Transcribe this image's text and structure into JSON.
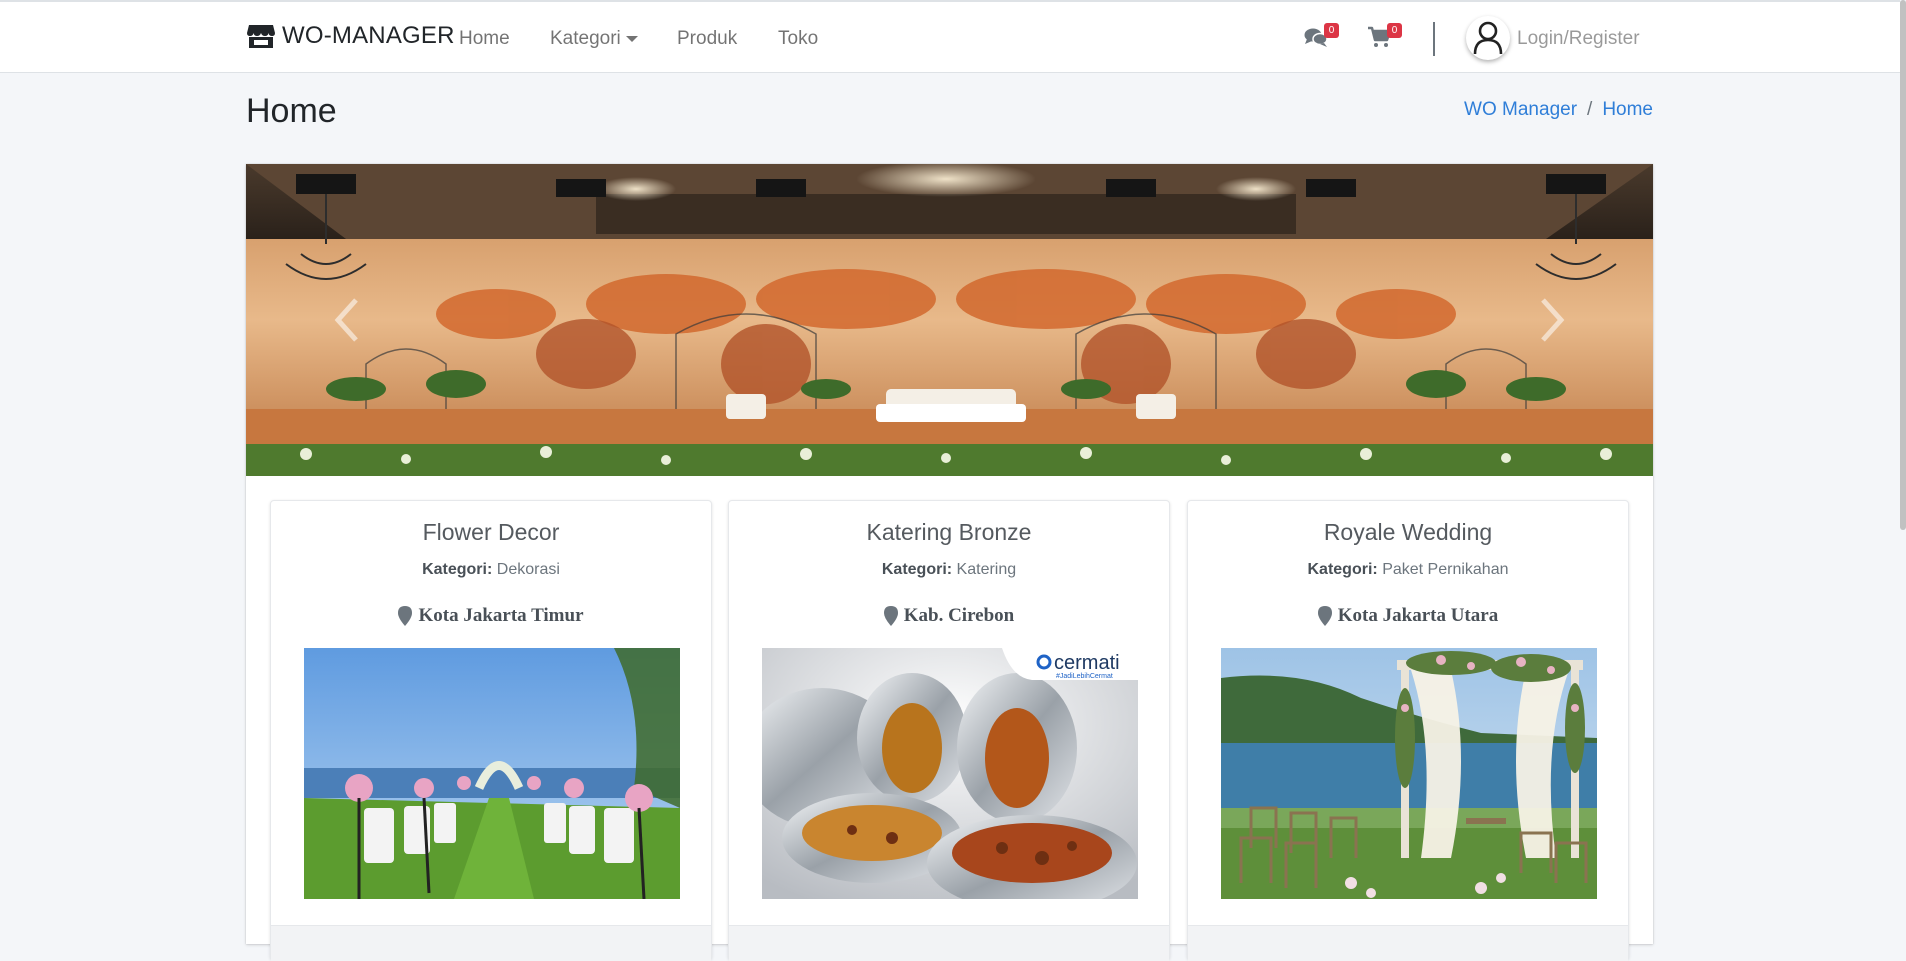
{
  "navbar": {
    "brand": "WO-MANAGER",
    "links": [
      {
        "label": "Home"
      },
      {
        "label": "Kategori"
      },
      {
        "label": "Produk"
      },
      {
        "label": "Toko"
      }
    ],
    "chat_badge": "0",
    "cart_badge": "0",
    "login_label": "Login/Register"
  },
  "header": {
    "title": "Home",
    "breadcrumb": [
      "WO Manager",
      "Home"
    ]
  },
  "carousel": {
    "slide_description": "wedding-stage-orange-flower-decoration"
  },
  "products": [
    {
      "title": "Flower Decor",
      "category_label": "Kategori:",
      "category": "Dekorasi",
      "location": "Kota Jakarta Timur"
    },
    {
      "title": "Katering Bronze",
      "category_label": "Kategori:",
      "category": "Katering",
      "location": "Kab. Cirebon",
      "watermark": "cermati",
      "watermark_tag": "#JadiLebihCermat"
    },
    {
      "title": "Royale Wedding",
      "category_label": "Kategori:",
      "category": "Paket Pernikahan",
      "location": "Kota Jakarta Utara"
    }
  ],
  "colors": {
    "accent": "#2f7ed8",
    "badge": "#dc3545",
    "background": "#f4f6f9"
  }
}
